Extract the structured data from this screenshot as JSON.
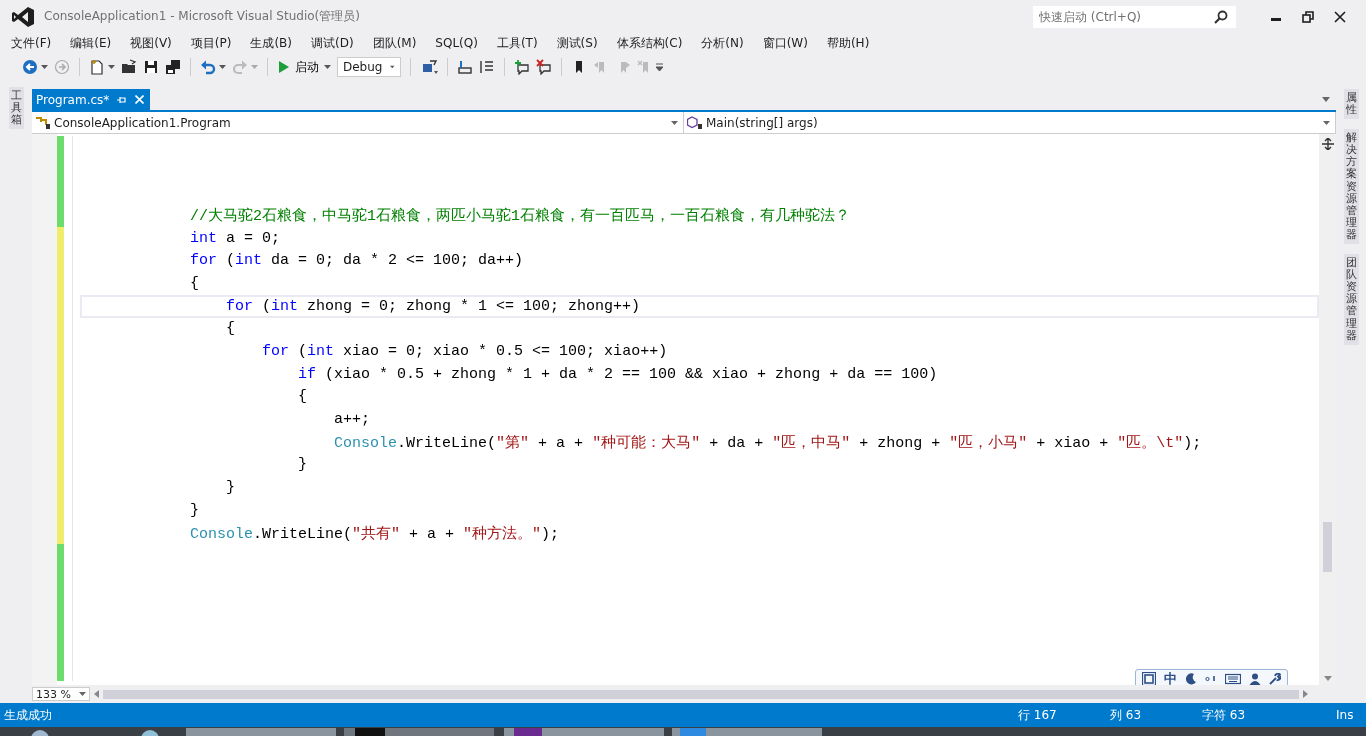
{
  "window": {
    "title": "ConsoleApplication1 - Microsoft Visual Studio(管理员)"
  },
  "quick_launch": {
    "placeholder": "快速启动 (Ctrl+Q)"
  },
  "menu": [
    "文件(F)",
    "编辑(E)",
    "视图(V)",
    "项目(P)",
    "生成(B)",
    "调试(D)",
    "团队(M)",
    "SQL(Q)",
    "工具(T)",
    "测试(S)",
    "体系结构(C)",
    "分析(N)",
    "窗口(W)",
    "帮助(H)"
  ],
  "toolbar": {
    "start_label": "启动",
    "configuration": "Debug"
  },
  "side_tabs_left": [
    "工具箱"
  ],
  "side_tabs_right": [
    "属性",
    "解决方案资源管理器",
    "团队资源管理器"
  ],
  "document_tabs": [
    {
      "label": "Program.cs*",
      "selected": true
    }
  ],
  "navigation": {
    "type_dropdown": "ConsoleApplication1.Program",
    "member_dropdown": "Main(string[] args)"
  },
  "editor": {
    "zoom": "133 %",
    "lines": [
      {
        "saved": true,
        "current": false
      },
      {
        "saved": true,
        "current": false
      },
      {
        "saved": true,
        "current": false
      },
      {
        "saved": true,
        "current": false,
        "tokens": [
          {
            "kind": "comment",
            "text": "            //大马驼2石粮食，中马驼1石粮食，两匹小马驼1石粮食，有一百匹马，一百石粮食，有几种驼法？"
          }
        ]
      },
      {
        "saved": false,
        "current": false,
        "tokens": [
          {
            "kind": "keyword",
            "text": "            int"
          },
          {
            "kind": "plain",
            "text": " a = 0;"
          }
        ]
      },
      {
        "saved": false,
        "current": false,
        "tokens": [
          {
            "kind": "keyword",
            "text": "            for"
          },
          {
            "kind": "plain",
            "text": " ("
          },
          {
            "kind": "keyword",
            "text": "int"
          },
          {
            "kind": "plain",
            "text": " da = 0; da * 2 <= 100; da++)"
          }
        ]
      },
      {
        "saved": false,
        "current": false,
        "tokens": [
          {
            "kind": "plain",
            "text": "            {"
          }
        ]
      },
      {
        "saved": false,
        "current": true,
        "tokens": [
          {
            "kind": "keyword",
            "text": "                for"
          },
          {
            "kind": "plain",
            "text": " ("
          },
          {
            "kind": "keyword",
            "text": "int"
          },
          {
            "kind": "plain",
            "text": " zhong = 0; zhong * 1 <= 100; zhong++)"
          }
        ]
      },
      {
        "saved": false,
        "current": false,
        "tokens": [
          {
            "kind": "plain",
            "text": "                {"
          }
        ]
      },
      {
        "saved": false,
        "current": false,
        "tokens": [
          {
            "kind": "keyword",
            "text": "                    for"
          },
          {
            "kind": "plain",
            "text": " ("
          },
          {
            "kind": "keyword",
            "text": "int"
          },
          {
            "kind": "plain",
            "text": " xiao = 0; xiao * 0.5 <= 100; xiao++)"
          }
        ]
      },
      {
        "saved": false,
        "current": false,
        "tokens": [
          {
            "kind": "keyword",
            "text": "                        if"
          },
          {
            "kind": "plain",
            "text": " (xiao * 0.5 + zhong * 1 + da * 2 == 100 && xiao + zhong + da == 100)"
          }
        ]
      },
      {
        "saved": false,
        "current": false,
        "tokens": [
          {
            "kind": "plain",
            "text": "                        {"
          }
        ]
      },
      {
        "saved": false,
        "current": false,
        "tokens": [
          {
            "kind": "plain",
            "text": "                            a++;"
          }
        ]
      },
      {
        "saved": false,
        "current": false,
        "tokens": [
          {
            "kind": "type",
            "text": "                            Console"
          },
          {
            "kind": "plain",
            "text": ".WriteLine("
          },
          {
            "kind": "string",
            "text": "\"第\""
          },
          {
            "kind": "plain",
            "text": " + a + "
          },
          {
            "kind": "string",
            "text": "\"种可能：大马\""
          },
          {
            "kind": "plain",
            "text": " + da + "
          },
          {
            "kind": "string",
            "text": "\"匹，中马\""
          },
          {
            "kind": "plain",
            "text": " + zhong + "
          },
          {
            "kind": "string",
            "text": "\"匹，小马\""
          },
          {
            "kind": "plain",
            "text": " + xiao + "
          },
          {
            "kind": "string",
            "text": "\"匹。\\t\""
          },
          {
            "kind": "plain",
            "text": ");"
          }
        ]
      },
      {
        "saved": false,
        "current": false,
        "tokens": [
          {
            "kind": "plain",
            "text": "                        }"
          }
        ]
      },
      {
        "saved": false,
        "current": false,
        "tokens": [
          {
            "kind": "plain",
            "text": "                }"
          }
        ]
      },
      {
        "saved": false,
        "current": false,
        "tokens": [
          {
            "kind": "plain",
            "text": "            }"
          }
        ]
      },
      {
        "saved": false,
        "current": false,
        "tokens": [
          {
            "kind": "type",
            "text": "            Console"
          },
          {
            "kind": "plain",
            "text": ".WriteLine("
          },
          {
            "kind": "string",
            "text": "\"共有\""
          },
          {
            "kind": "plain",
            "text": " + a + "
          },
          {
            "kind": "string",
            "text": "\"种方法。\""
          },
          {
            "kind": "plain",
            "text": ");"
          }
        ]
      },
      {
        "saved": true,
        "current": false
      },
      {
        "saved": true,
        "current": false
      },
      {
        "saved": true,
        "current": false
      },
      {
        "saved": true,
        "current": false
      },
      {
        "saved": true,
        "current": false
      },
      {
        "saved": true,
        "current": false
      }
    ]
  },
  "ime_toolbar": {
    "mode": "中"
  },
  "status_bar": {
    "message": "生成成功",
    "line": "行 167",
    "column": "列 63",
    "character": "字符 63",
    "mode": "Ins"
  }
}
